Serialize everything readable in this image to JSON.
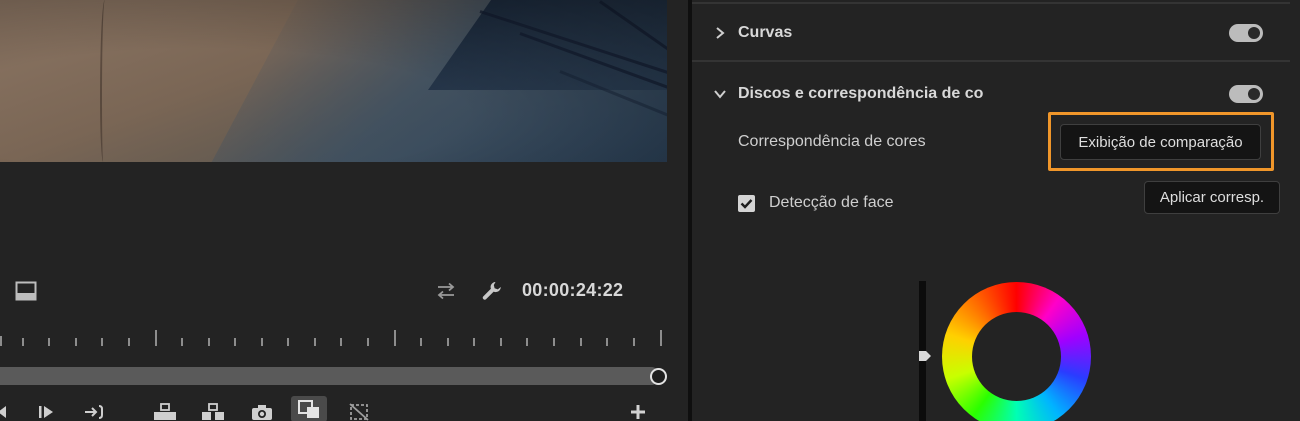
{
  "monitor": {
    "timecode": "00:00:24:22",
    "icons": {
      "safe_margins": "safe-margins-icon",
      "toggle_proxy": "swap-arrows-icon",
      "settings": "wrench-icon",
      "step_back": "step-back-icon",
      "step_forward": "step-forward-icon",
      "go_to_out": "go-to-out-point-icon",
      "lift": "lift-icon",
      "extract": "extract-icon",
      "export_frame": "camera-icon",
      "comparison_view": "comparison-view-icon",
      "proxy": "proxy-icon",
      "add_button": "plus-icon"
    }
  },
  "panel": {
    "curves": {
      "title": "Curvas",
      "enabled": true
    },
    "color_wheels": {
      "title": "Discos e correspondência de co",
      "enabled": true,
      "color_match_label": "Correspondência de cores",
      "comparison_button": "Exibição de comparação",
      "apply_button": "Aplicar corresp.",
      "face_detection_label": "Detecção de face",
      "face_detection_checked": true
    }
  },
  "colors": {
    "highlight": "#f0962a",
    "toggle_on": "#bcbcbc",
    "panel_bg": "#232323"
  }
}
